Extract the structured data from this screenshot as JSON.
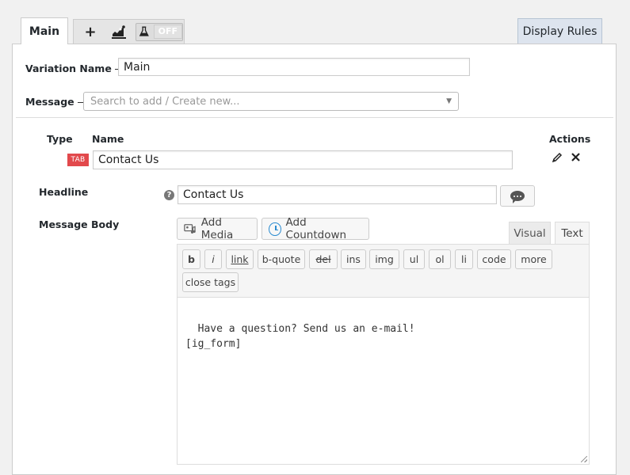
{
  "tabs": {
    "main_label": "Main",
    "add_icon": "+",
    "analytics_icon": "chart-icon",
    "test_toggle_label": "OFF",
    "display_rules_label": "Display Rules"
  },
  "form": {
    "variation_name_label": "Variation Name",
    "variation_name_value": "Main",
    "message_label": "Message",
    "message_placeholder": "Search to add / Create new..."
  },
  "table": {
    "headers": {
      "type": "Type",
      "name": "Name",
      "actions": "Actions"
    },
    "row": {
      "type_badge": "TAB",
      "name_value": "Contact Us"
    }
  },
  "headline": {
    "label": "Headline",
    "help_symbol": "?",
    "value": "Contact Us"
  },
  "message_body": {
    "label": "Message Body",
    "add_media_label": "Add Media",
    "add_countdown_label": "Add Countdown",
    "mode_visual": "Visual",
    "mode_text": "Text",
    "quicktags": [
      "b",
      "i",
      "link",
      "b-quote",
      "del",
      "ins",
      "img",
      "ul",
      "ol",
      "li",
      "code",
      "more",
      "close tags"
    ],
    "content": "Have a question? Send us an e-mail!\n[ig_form]"
  },
  "colors": {
    "badge_red": "#e2494c",
    "display_rules_bg": "#dde4ee",
    "countdown_icon_blue": "#2a8bd0"
  }
}
